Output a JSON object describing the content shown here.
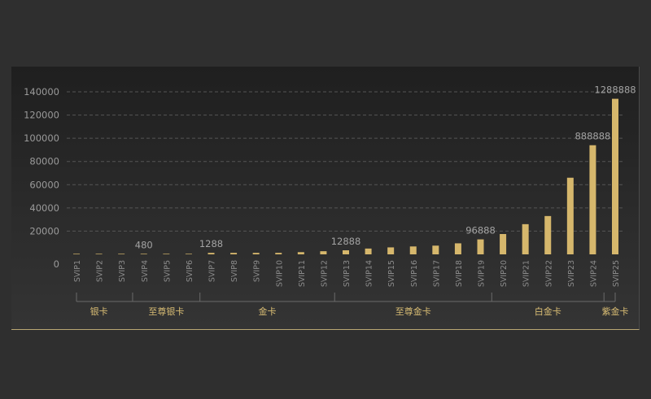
{
  "chart_data": {
    "type": "bar",
    "categories": [
      "SVIP1",
      "SVIP2",
      "SVIP3",
      "SVIP4",
      "SVIP5",
      "SVIP6",
      "SVIP7",
      "SVIP8",
      "SVIP9",
      "SVIP10",
      "SVIP11",
      "SVIP12",
      "SVIP13",
      "SVIP14",
      "SVIP15",
      "SVIP16",
      "SVIP17",
      "SVIP18",
      "SVIP19",
      "SVIP20",
      "SVIP21",
      "SVIP22",
      "SVIP23",
      "SVIP24",
      "SVIP25"
    ],
    "values": [
      480,
      480,
      480,
      480,
      480,
      480,
      1288,
      1288,
      1288,
      1288,
      1900,
      2700,
      3500,
      5000,
      6000,
      6800,
      7500,
      9500,
      12888,
      17500,
      26000,
      33000,
      66000,
      94000,
      134000
    ],
    "data_labels": [
      {
        "index": 3,
        "text": "480"
      },
      {
        "index": 6,
        "text": "1288"
      },
      {
        "index": 12,
        "text": "12888"
      },
      {
        "index": 18,
        "text": "96888"
      },
      {
        "index": 23,
        "text": "888888"
      },
      {
        "index": 24,
        "text": "1288888"
      }
    ],
    "yticks": [
      0,
      20000,
      40000,
      60000,
      80000,
      100000,
      120000,
      140000
    ],
    "ylim": [
      0,
      140000
    ],
    "grid": true,
    "colors": {
      "bar": "#d6b76c",
      "grid": "#555555",
      "tier_text": "#d9bd74"
    },
    "tiers": [
      {
        "name": "银卡",
        "start": 0,
        "end": 2
      },
      {
        "name": "至尊银卡",
        "start": 3,
        "end": 5
      },
      {
        "name": "金卡",
        "start": 6,
        "end": 11
      },
      {
        "name": "至尊金卡",
        "start": 12,
        "end": 18
      },
      {
        "name": "白金卡",
        "start": 19,
        "end": 23
      },
      {
        "name": "紫金卡",
        "start": 24,
        "end": 24
      }
    ]
  }
}
